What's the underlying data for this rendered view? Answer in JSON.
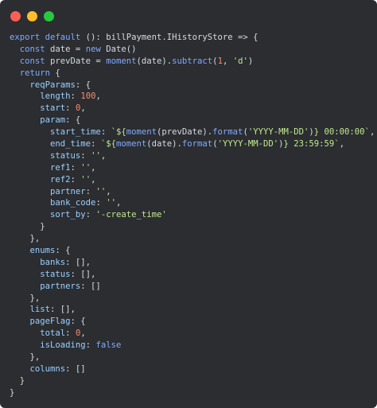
{
  "window": {
    "controls": [
      "close",
      "minimize",
      "zoom"
    ],
    "colors": {
      "background": "#2b2d31",
      "close": "#ff5f56",
      "minimize": "#ffbd2e",
      "zoom": "#27c93f"
    }
  },
  "code": {
    "lines": [
      [
        {
          "t": "export default",
          "c": "kw"
        },
        {
          "t": " (): ",
          "c": "op"
        },
        {
          "t": "billPayment",
          "c": "id"
        },
        {
          "t": ".",
          "c": "op"
        },
        {
          "t": "IHistoryStore",
          "c": "id"
        },
        {
          "t": " => {",
          "c": "op"
        }
      ],
      [
        {
          "t": "  const",
          "c": "kw"
        },
        {
          "t": " date = ",
          "c": "id"
        },
        {
          "t": "new",
          "c": "kw"
        },
        {
          "t": " Date()",
          "c": "id"
        }
      ],
      [
        {
          "t": "  const",
          "c": "kw"
        },
        {
          "t": " prevDate = ",
          "c": "id"
        },
        {
          "t": "moment",
          "c": "fn"
        },
        {
          "t": "(date).",
          "c": "id"
        },
        {
          "t": "subtract",
          "c": "fn"
        },
        {
          "t": "(",
          "c": "op"
        },
        {
          "t": "1",
          "c": "num"
        },
        {
          "t": ", ",
          "c": "op"
        },
        {
          "t": "'d'",
          "c": "str"
        },
        {
          "t": ")",
          "c": "op"
        }
      ],
      [
        {
          "t": "  return",
          "c": "kw"
        },
        {
          "t": " {",
          "c": "op"
        }
      ],
      [
        {
          "t": "    reqParams",
          "c": "prop"
        },
        {
          "t": ": {",
          "c": "op"
        }
      ],
      [
        {
          "t": "      length",
          "c": "prop"
        },
        {
          "t": ": ",
          "c": "op"
        },
        {
          "t": "100",
          "c": "num"
        },
        {
          "t": ",",
          "c": "op"
        }
      ],
      [
        {
          "t": "      start",
          "c": "prop"
        },
        {
          "t": ": ",
          "c": "op"
        },
        {
          "t": "0",
          "c": "num"
        },
        {
          "t": ",",
          "c": "op"
        }
      ],
      [
        {
          "t": "      param",
          "c": "prop"
        },
        {
          "t": ": {",
          "c": "op"
        }
      ],
      [
        {
          "t": "        start_time",
          "c": "prop"
        },
        {
          "t": ": ",
          "c": "op"
        },
        {
          "t": "`${",
          "c": "tpl"
        },
        {
          "t": "moment",
          "c": "fn"
        },
        {
          "t": "(prevDate).",
          "c": "id"
        },
        {
          "t": "format",
          "c": "fn"
        },
        {
          "t": "(",
          "c": "op"
        },
        {
          "t": "'YYYY-MM-DD'",
          "c": "str"
        },
        {
          "t": ")",
          "c": "op"
        },
        {
          "t": "} 00:00:00`",
          "c": "tpl"
        },
        {
          "t": ",",
          "c": "op"
        }
      ],
      [
        {
          "t": "        end_time",
          "c": "prop"
        },
        {
          "t": ": ",
          "c": "op"
        },
        {
          "t": "`${",
          "c": "tpl"
        },
        {
          "t": "moment",
          "c": "fn"
        },
        {
          "t": "(date).",
          "c": "id"
        },
        {
          "t": "format",
          "c": "fn"
        },
        {
          "t": "(",
          "c": "op"
        },
        {
          "t": "'YYYY-MM-DD'",
          "c": "str"
        },
        {
          "t": ")",
          "c": "op"
        },
        {
          "t": "} 23:59:59`",
          "c": "tpl"
        },
        {
          "t": ",",
          "c": "op"
        }
      ],
      [
        {
          "t": "        status",
          "c": "prop"
        },
        {
          "t": ": ",
          "c": "op"
        },
        {
          "t": "''",
          "c": "str"
        },
        {
          "t": ",",
          "c": "op"
        }
      ],
      [
        {
          "t": "        ref1",
          "c": "prop"
        },
        {
          "t": ": ",
          "c": "op"
        },
        {
          "t": "''",
          "c": "str"
        },
        {
          "t": ",",
          "c": "op"
        }
      ],
      [
        {
          "t": "        ref2",
          "c": "prop"
        },
        {
          "t": ": ",
          "c": "op"
        },
        {
          "t": "''",
          "c": "str"
        },
        {
          "t": ",",
          "c": "op"
        }
      ],
      [
        {
          "t": "        partner",
          "c": "prop"
        },
        {
          "t": ": ",
          "c": "op"
        },
        {
          "t": "''",
          "c": "str"
        },
        {
          "t": ",",
          "c": "op"
        }
      ],
      [
        {
          "t": "        bank_code",
          "c": "prop"
        },
        {
          "t": ": ",
          "c": "op"
        },
        {
          "t": "''",
          "c": "str"
        },
        {
          "t": ",",
          "c": "op"
        }
      ],
      [
        {
          "t": "        sort_by",
          "c": "prop"
        },
        {
          "t": ": ",
          "c": "op"
        },
        {
          "t": "'-create_time'",
          "c": "str"
        }
      ],
      [
        {
          "t": "      }",
          "c": "op"
        }
      ],
      [
        {
          "t": "    },",
          "c": "op"
        }
      ],
      [
        {
          "t": "    enums",
          "c": "prop"
        },
        {
          "t": ": {",
          "c": "op"
        }
      ],
      [
        {
          "t": "      banks",
          "c": "prop"
        },
        {
          "t": ": [],",
          "c": "op"
        }
      ],
      [
        {
          "t": "      status",
          "c": "prop"
        },
        {
          "t": ": [],",
          "c": "op"
        }
      ],
      [
        {
          "t": "      partners",
          "c": "prop"
        },
        {
          "t": ": []",
          "c": "op"
        }
      ],
      [
        {
          "t": "    },",
          "c": "op"
        }
      ],
      [
        {
          "t": "    list",
          "c": "prop"
        },
        {
          "t": ": [],",
          "c": "op"
        }
      ],
      [
        {
          "t": "    pageFlag",
          "c": "prop"
        },
        {
          "t": ": {",
          "c": "op"
        }
      ],
      [
        {
          "t": "      total",
          "c": "prop"
        },
        {
          "t": ": ",
          "c": "op"
        },
        {
          "t": "0",
          "c": "num"
        },
        {
          "t": ",",
          "c": "op"
        }
      ],
      [
        {
          "t": "      isLoading",
          "c": "prop"
        },
        {
          "t": ": ",
          "c": "op"
        },
        {
          "t": "false",
          "c": "kw"
        }
      ],
      [
        {
          "t": "    },",
          "c": "op"
        }
      ],
      [
        {
          "t": "    columns",
          "c": "prop"
        },
        {
          "t": ": []",
          "c": "op"
        }
      ],
      [
        {
          "t": "  }",
          "c": "op"
        }
      ],
      [
        {
          "t": "}",
          "c": "op"
        }
      ]
    ]
  }
}
